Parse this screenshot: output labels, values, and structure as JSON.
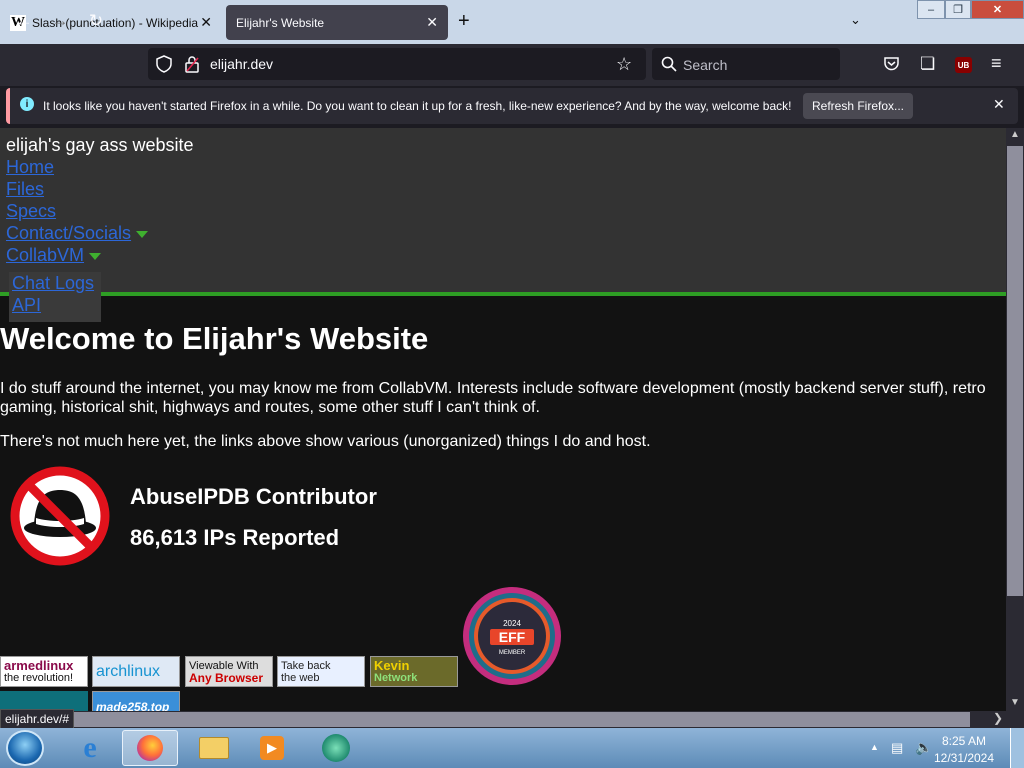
{
  "browser": {
    "tabs": [
      {
        "title": "Slash (punctuation) - Wikipedia",
        "favicon": "W",
        "active": false
      },
      {
        "title": "Elijahr's Website",
        "active": true
      }
    ],
    "url": "elijahr.dev",
    "search_placeholder": "Search",
    "notification": {
      "message": "It looks like you haven't started Firefox in a while. Do you want to clean it up for a fresh, like-new experience? And by the way, welcome back!",
      "button_label": "Refresh Firefox..."
    },
    "status_url": "elijahr.dev/#",
    "extension_badge": "UB"
  },
  "page": {
    "site_name": "elijah's gay ass website",
    "nav": {
      "home": "Home",
      "files": "Files",
      "specs": "Specs",
      "contact": "Contact/Socials",
      "collabvm": "CollabVM"
    },
    "dropdown": {
      "chat_logs": "Chat Logs",
      "api": "API"
    },
    "heading": "Welcome to Elijahr's Website",
    "intro": "I do stuff around the internet, you may know me from CollabVM. Interests include software development (mostly backend server stuff), retro gaming, historical shit, highways and routes, some other stuff I can't think of.",
    "note": "There's not much here yet, the links above show various (unorganized) things I do and host.",
    "abuseipdb": {
      "title": "AbuseIPDB Contributor",
      "count": "86,613 IPs Reported"
    },
    "eff_badge": {
      "year": "2024",
      "name": "EFF",
      "label": "MEMBER"
    },
    "badges": {
      "armed_1": "armedlinux",
      "armed_2": "the revolution!",
      "arch": "archlinux",
      "anybrowser_1": "Viewable With",
      "anybrowser_2": "Any Browser",
      "takeback_1": "Take back",
      "takeback_2": "the web",
      "kevin_1": "Kevin",
      "kevin_2": "Network",
      "made": "made258.top"
    }
  },
  "taskbar": {
    "time": "8:25 AM",
    "date": "12/31/2024"
  },
  "colors": {
    "accent_green": "#2e9e24",
    "link_blue": "#2c67d8",
    "header_gray": "#333333",
    "background": "#121212"
  }
}
